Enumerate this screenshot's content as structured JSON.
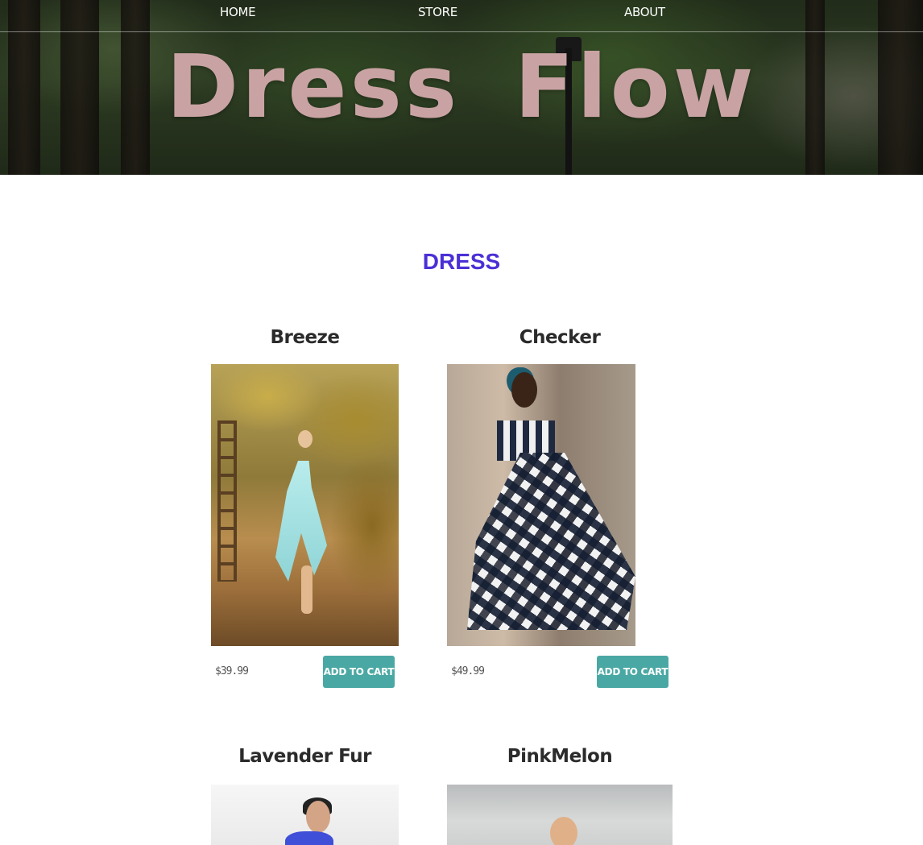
{
  "nav": {
    "home": "HOME",
    "store": "STORE",
    "about": "ABOUT"
  },
  "brand": {
    "title": "Dress Flow",
    "color": "#c9a3a3"
  },
  "section": {
    "title": "DRESS",
    "color": "#4b2fd6"
  },
  "products": [
    {
      "name": "Breeze",
      "price": "$39.99",
      "button": "ADD TO CART"
    },
    {
      "name": "Checker",
      "price": "$49.99",
      "button": "ADD TO CART"
    },
    {
      "name": "Lavender Fur"
    },
    {
      "name": "PinkMelon"
    }
  ],
  "accent": "#4aa8a4"
}
